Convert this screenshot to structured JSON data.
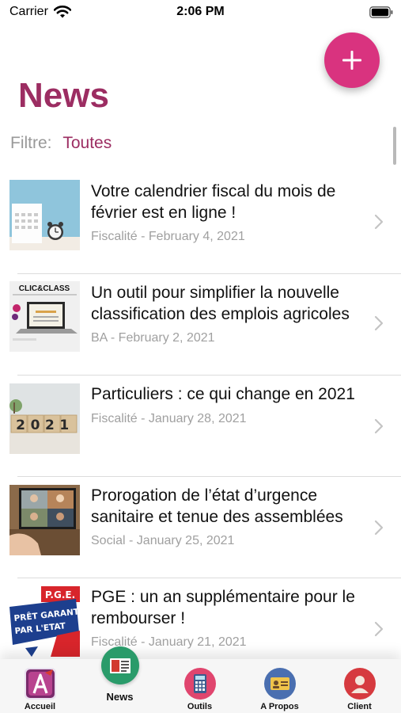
{
  "status_bar": {
    "carrier": "Carrier",
    "time": "2:06 PM"
  },
  "fab": {
    "icon": "plus-icon",
    "color": "#d9337f"
  },
  "page": {
    "title": "News",
    "title_color": "#9c2d62"
  },
  "filter": {
    "label": "Filtre:",
    "value": "Toutes"
  },
  "news": [
    {
      "title": "Votre calendrier fiscal du mois de février est en ligne !",
      "category": "Fiscalité",
      "date": "February 4, 2021",
      "meta": "Fiscalité - February 4, 2021",
      "thumbnail": "calendar-alarm-clock-photo"
    },
    {
      "title": "Un outil pour simplifier la nouvelle classification des emplois agricoles",
      "category": "BA",
      "date": "February 2, 2021",
      "meta": "BA - February 2, 2021",
      "thumbnail": "clic-and-class-laptop-photo",
      "thumbnail_text": "CLIC&CLASS"
    },
    {
      "title": "Particuliers : ce qui change en 2021",
      "category": "Fiscalité",
      "date": "January 28, 2021",
      "meta": "Fiscalité - January 28, 2021",
      "thumbnail": "wooden-blocks-2021-photo",
      "thumbnail_text": "2021"
    },
    {
      "title": "Prorogation de l’état d’urgence sanitaire et tenue des assemblées",
      "category": "Social",
      "date": "January 25, 2021",
      "meta": "Social - January 25, 2021",
      "thumbnail": "video-conference-laptop-photo"
    },
    {
      "title": "PGE : un an supplémentaire pour le rembourser !",
      "category": "Fiscalité",
      "date": "January 21, 2021",
      "meta": "Fiscalité - January 21, 2021",
      "thumbnail": "pret-garanti-par-etat-photo",
      "thumbnail_text": [
        "P.G.E.",
        "PRÊT GARANTI",
        "PAR L'ETAT"
      ]
    }
  ],
  "tab_bar": {
    "tabs": [
      {
        "label": "Accueil",
        "icon": "accueil-logo-icon",
        "active": false
      },
      {
        "label": "News",
        "icon": "newspaper-icon",
        "active": true
      },
      {
        "label": "Outils",
        "icon": "calculator-icon",
        "active": false
      },
      {
        "label": "A Propos",
        "icon": "id-card-icon",
        "active": false
      },
      {
        "label": "Client",
        "icon": "user-icon",
        "active": false
      }
    ]
  }
}
